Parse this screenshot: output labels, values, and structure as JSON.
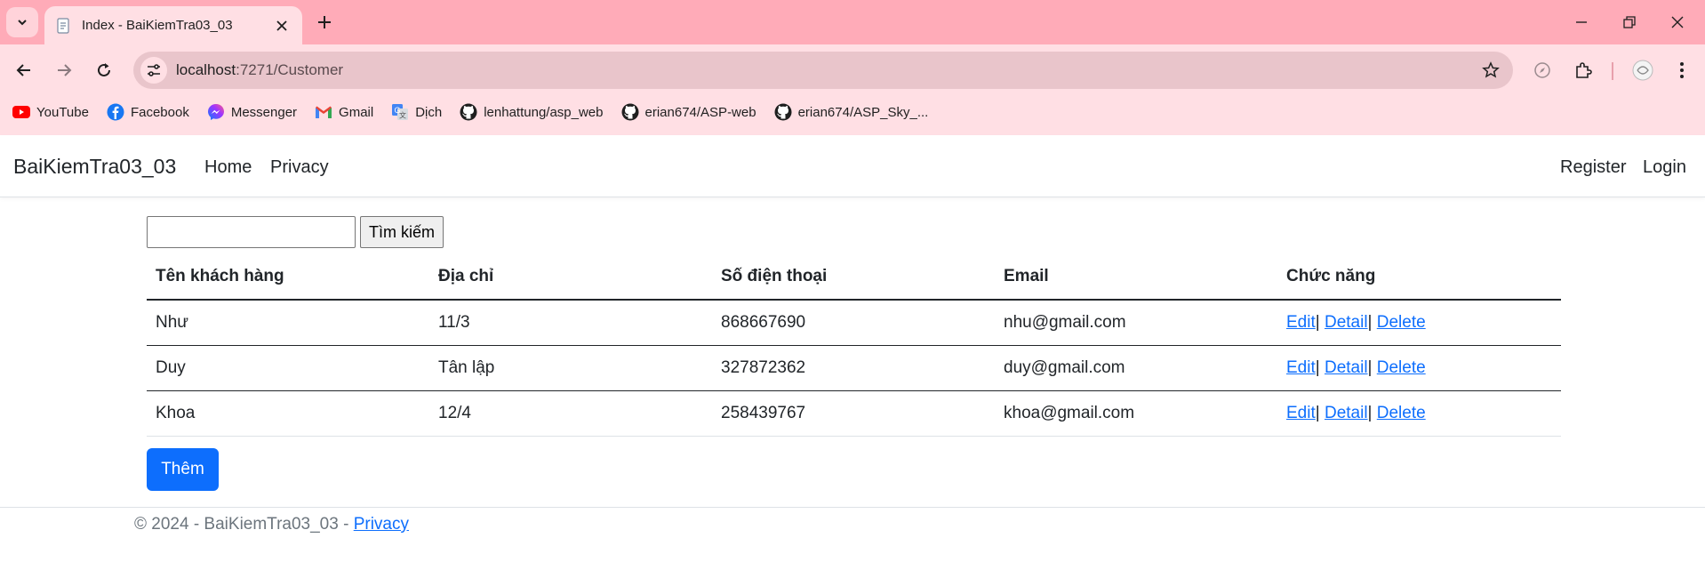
{
  "browser": {
    "tab_title": "Index - BaiKiemTra03_03",
    "url_host": "localhost",
    "url_path": ":7271/Customer",
    "bookmarks": [
      {
        "label": "YouTube",
        "icon": "youtube-icon"
      },
      {
        "label": "Facebook",
        "icon": "facebook-icon"
      },
      {
        "label": "Messenger",
        "icon": "messenger-icon"
      },
      {
        "label": "Gmail",
        "icon": "gmail-icon"
      },
      {
        "label": "Dịch",
        "icon": "translate-icon"
      },
      {
        "label": "lenhattung/asp_web",
        "icon": "github-icon"
      },
      {
        "label": "erian674/ASP-web",
        "icon": "github-icon"
      },
      {
        "label": "erian674/ASP_Sky_...",
        "icon": "github-icon"
      }
    ],
    "colors": {
      "tabbar": "#ffabb8",
      "toolbar": "#ffdfe4"
    }
  },
  "navbar": {
    "brand": "BaiKiemTra03_03",
    "links": [
      "Home",
      "Privacy"
    ],
    "right_links": [
      "Register",
      "Login"
    ]
  },
  "search": {
    "value": "",
    "button_label": "Tìm kiếm"
  },
  "table": {
    "headers": [
      "Tên khách hàng",
      "Địa chỉ",
      "Số điện thoại",
      "Email",
      "Chức năng"
    ],
    "rows": [
      {
        "name": "Như",
        "address": "11/3",
        "phone": "868667690",
        "email": "nhu@gmail.com"
      },
      {
        "name": "Duy",
        "address": "Tân lập",
        "phone": "327872362",
        "email": "duy@gmail.com"
      },
      {
        "name": "Khoa",
        "address": "12/4",
        "phone": "258439767",
        "email": "khoa@gmail.com"
      }
    ],
    "actions": {
      "edit": "Edit",
      "detail": "Detail",
      "delete": "Delete",
      "separator": "|"
    }
  },
  "add_button": "Thêm",
  "footer": {
    "text": "© 2024 - BaiKiemTra03_03 - ",
    "link": "Privacy"
  },
  "accent_color": "#0d6efd"
}
